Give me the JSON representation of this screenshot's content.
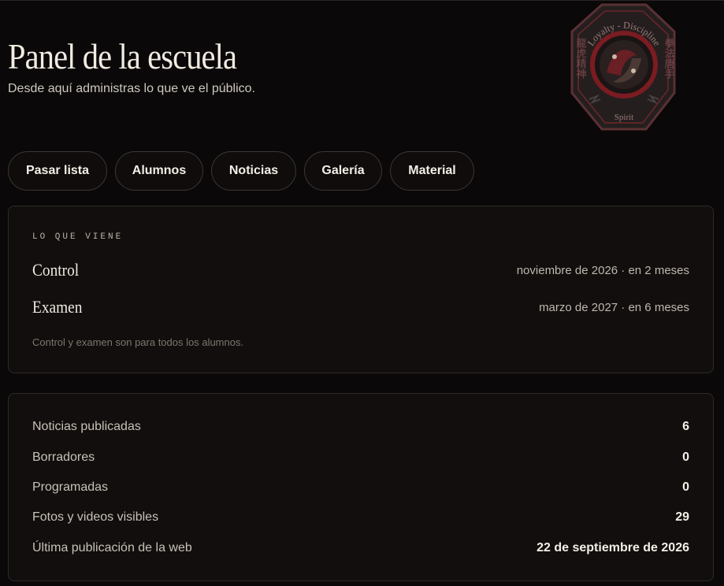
{
  "header": {
    "title": "Panel de la escuela",
    "subtitle": "Desde aquí administras lo que ve el público."
  },
  "logo": {
    "top_text": "Loyalty - Discipline",
    "bottom_text": "Spirit",
    "left_glyphs": "龍虎精神",
    "right_glyphs": "拳法唐手",
    "icon": "dragon-tiger-emblem-icon"
  },
  "nav": {
    "items": [
      {
        "label": "Pasar lista"
      },
      {
        "label": "Alumnos"
      },
      {
        "label": "Noticias"
      },
      {
        "label": "Galería"
      },
      {
        "label": "Material"
      }
    ]
  },
  "upcoming": {
    "section_label": "LO QUE VIENE",
    "events": [
      {
        "name": "Control",
        "when": "noviembre de 2026 · en 2 meses"
      },
      {
        "name": "Examen",
        "when": "marzo de 2027 · en 6 meses"
      }
    ],
    "note": "Control y examen son para todos los alumnos."
  },
  "stats": {
    "rows": [
      {
        "label": "Noticias publicadas",
        "value": "6"
      },
      {
        "label": "Borradores",
        "value": "0"
      },
      {
        "label": "Programadas",
        "value": "0"
      },
      {
        "label": "Fotos y videos visibles",
        "value": "29"
      },
      {
        "label": "Última publicación de la web",
        "value": "22 de septiembre de 2026"
      }
    ]
  },
  "colors": {
    "background": "#0a0808",
    "card": "#110e0d",
    "border": "#2f2a27",
    "emblem_red": "#7a1c22"
  }
}
